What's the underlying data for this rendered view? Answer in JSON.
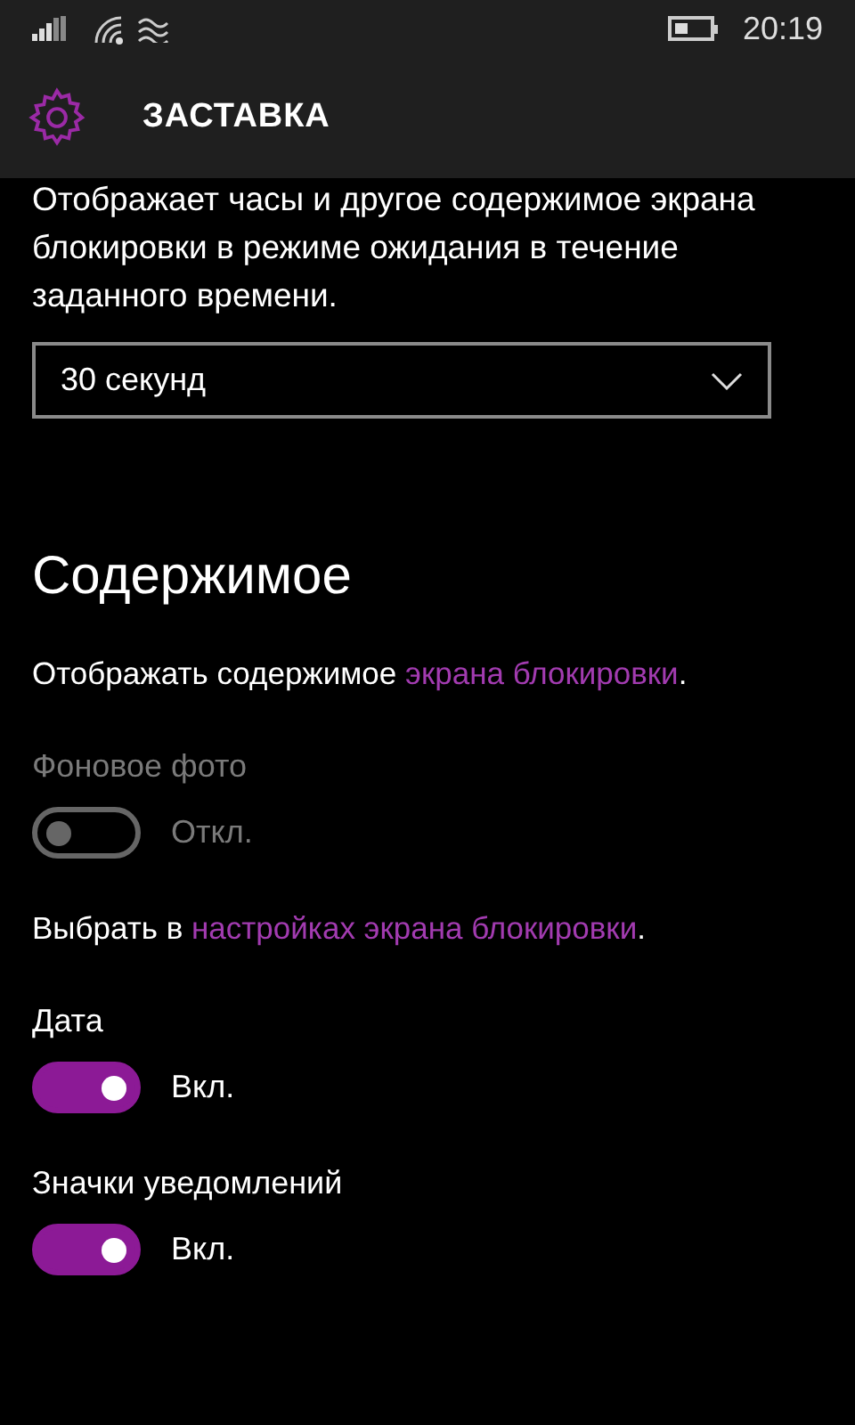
{
  "status_bar": {
    "time": "20:19"
  },
  "header": {
    "title": "ЗАСТАВКА"
  },
  "description": "Отображает часы и другое содержимое экрана блокировки в режиме ожидания в течение заданного времени.",
  "timeout_dropdown": {
    "value": "30 секунд"
  },
  "section_title": "Содержимое",
  "items": [
    {
      "kind": "sentence",
      "before": "Отображать содержимое ",
      "link": "экрана блокировки",
      "after": "."
    },
    {
      "kind": "toggle",
      "label": "Фоновое фото",
      "on": false,
      "disabled": true,
      "state_text": "Откл."
    },
    {
      "kind": "sentence",
      "before": "Выбрать в ",
      "link": "настройках экрана блокировки",
      "after": "."
    },
    {
      "kind": "toggle",
      "label": "Дата",
      "on": true,
      "disabled": false,
      "state_text": "Вкл."
    },
    {
      "kind": "toggle",
      "label": "Значки уведомлений",
      "on": true,
      "disabled": false,
      "state_text": "Вкл."
    }
  ]
}
